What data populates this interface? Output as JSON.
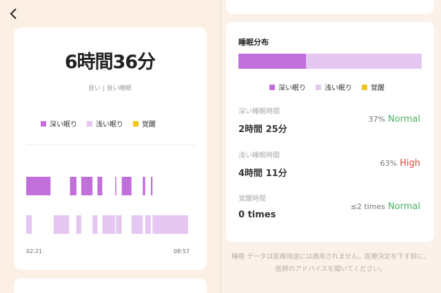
{
  "colors": {
    "deep": "#c06fdb",
    "light": "#e5c7f2",
    "awake": "#f2c522",
    "normal": "#4caf62",
    "high": "#e0453d"
  },
  "summary": {
    "back_icon": "chevron-left-icon",
    "duration": "6時間36分",
    "quality": "良い | 良い睡眠",
    "legend": [
      {
        "label": "深い眠り",
        "color": "#c06fdb"
      },
      {
        "label": "浅い眠り",
        "color": "#e5c7f2"
      },
      {
        "label": "覚醒",
        "color": "#f2c522"
      }
    ],
    "start_time": "02:21",
    "end_time": "08:57",
    "stages": {
      "deep": [
        [
          0.0,
          0.15
        ],
        [
          0.27,
          0.31
        ],
        [
          0.34,
          0.41
        ],
        [
          0.44,
          0.47
        ],
        [
          0.55,
          0.555
        ],
        [
          0.59,
          0.65
        ],
        [
          0.72,
          0.735
        ],
        [
          0.77,
          0.78
        ]
      ],
      "light": [
        [
          0.0,
          0.035
        ],
        [
          0.17,
          0.265
        ],
        [
          0.31,
          0.34
        ],
        [
          0.41,
          0.44
        ],
        [
          0.47,
          0.55
        ],
        [
          0.555,
          0.59
        ],
        [
          0.65,
          0.72
        ],
        [
          0.735,
          0.77
        ],
        [
          0.78,
          1.0
        ]
      ]
    }
  },
  "distribution": {
    "title": "睡眠分布",
    "deep_percent": 37,
    "light_percent": 63,
    "legend": [
      {
        "label": "深い眠り",
        "color": "#c06fdb"
      },
      {
        "label": "浅い眠り",
        "color": "#e5c7f2"
      },
      {
        "label": "覚醒",
        "color": "#f2c522"
      }
    ],
    "stats": [
      {
        "label": "深い睡眠時間",
        "value": "2時間 25分",
        "ratio": "37%",
        "status": "Normal",
        "level": "normal"
      },
      {
        "label": "浅い睡眠時間",
        "value": "4時間 11分",
        "ratio": "63%",
        "status": "High",
        "level": "high"
      },
      {
        "label": "覚醒時間",
        "value": "0 times",
        "ratio": "≤2 times",
        "status": "Normal",
        "level": "normal"
      }
    ],
    "disclaimer": "睡眠 データは医療用途には適用されません。医療決定を下す前に、医師のアドバイスを聞いてください。"
  }
}
